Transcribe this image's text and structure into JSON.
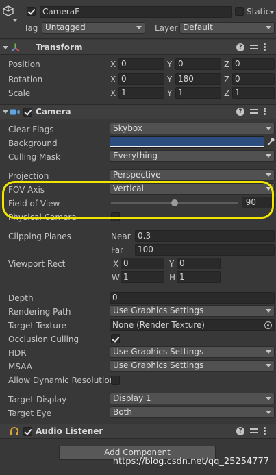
{
  "object": {
    "name": "CameraF",
    "static_label": "Static",
    "tag_label": "Tag",
    "tag_value": "Untagged",
    "layer_label": "Layer",
    "layer_value": "Default"
  },
  "transform": {
    "title": "Transform",
    "position_label": "Position",
    "rotation_label": "Rotation",
    "scale_label": "Scale",
    "axis_x": "X",
    "axis_y": "Y",
    "axis_z": "Z",
    "position": [
      "0",
      "0",
      "0"
    ],
    "rotation": [
      "0",
      "180",
      "0"
    ],
    "scale": [
      "1",
      "1",
      "1"
    ]
  },
  "camera": {
    "title": "Camera",
    "clear_flags_label": "Clear Flags",
    "clear_flags": "Skybox",
    "background_label": "Background",
    "background_color": "#2b4d80",
    "culling_mask_label": "Culling Mask",
    "culling_mask": "Everything",
    "projection_label": "Projection",
    "projection": "Perspective",
    "fov_axis_label": "FOV Axis",
    "fov_axis": "Vertical",
    "fov_label": "Field of View",
    "fov": "90",
    "fov_fraction": 0.5,
    "physical_label": "Physical Camera",
    "clipping_label": "Clipping Planes",
    "near_label": "Near",
    "near": "0.3",
    "far_label": "Far",
    "far": "100",
    "viewport_label": "Viewport Rect",
    "vx_label": "X",
    "vx": "0",
    "vy_label": "Y",
    "vy": "0",
    "vw_label": "W",
    "vw": "1",
    "vh_label": "H",
    "vh": "1",
    "depth_label": "Depth",
    "depth": "0",
    "rendering_path_label": "Rendering Path",
    "rendering_path": "Use Graphics Settings",
    "target_texture_label": "Target Texture",
    "target_texture": "None (Render Texture)",
    "occlusion_label": "Occlusion Culling",
    "occlusion": true,
    "hdr_label": "HDR",
    "hdr": "Use Graphics Settings",
    "msaa_label": "MSAA",
    "msaa": "Use Graphics Settings",
    "dyn_res_label": "Allow Dynamic Resolution",
    "dyn_res": false,
    "target_display_label": "Target Display",
    "target_display": "Display 1",
    "target_eye_label": "Target Eye",
    "target_eye": "Both"
  },
  "audio_listener": {
    "title": "Audio Listener"
  },
  "add_component_label": "Add Component",
  "watermark": "https://blog.csdn.net/qq_25254777",
  "colors": {
    "highlight": "#f2e600",
    "panel": "#383838",
    "header": "#3e3e3e"
  }
}
